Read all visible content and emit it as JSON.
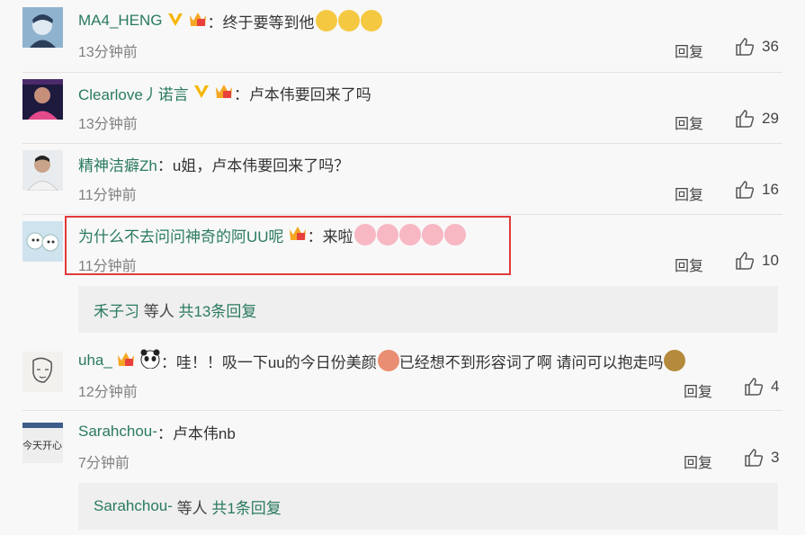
{
  "comments": [
    {
      "user": "MA4_HENG",
      "text": "终于要等到他",
      "time": "13分钟前",
      "reply": "回复",
      "likes": "36"
    },
    {
      "user": "Clearlove丿诺言",
      "text": "卢本伟要回来了吗",
      "time": "13分钟前",
      "reply": "回复",
      "likes": "29"
    },
    {
      "user": "精神洁癖Zh",
      "text": "u姐，卢本伟要回来了吗？",
      "time": "11分钟前",
      "reply": "回复",
      "likes": "16"
    },
    {
      "user": "为什么不去问问神奇的阿UU呢",
      "text": "来啦",
      "time": "11分钟前",
      "reply": "回复",
      "likes": "10"
    },
    {
      "user": "uha_",
      "text": "哇！！吸一下uu的今日份美颜",
      "text2": "已经想不到形容词了啊  请问可以抱走吗",
      "time": "12分钟前",
      "reply": "回复",
      "likes": "4"
    },
    {
      "user": "Sarahchou-",
      "text": "卢本伟nb",
      "time": "7分钟前",
      "reply": "回复",
      "likes": "3"
    }
  ],
  "more_replies": [
    {
      "users": "禾子习",
      "middle": " 等人 ",
      "count": "共13条回复"
    },
    {
      "users": "Sarahchou-",
      "middle": " 等人 ",
      "count": "共1条回复"
    }
  ],
  "avatar_texts": {
    "sarahchou": "今天开心"
  },
  "colors": {
    "username": "#2a7a5f",
    "highlight": "#e03b3b",
    "background": "#f8f8f8"
  }
}
